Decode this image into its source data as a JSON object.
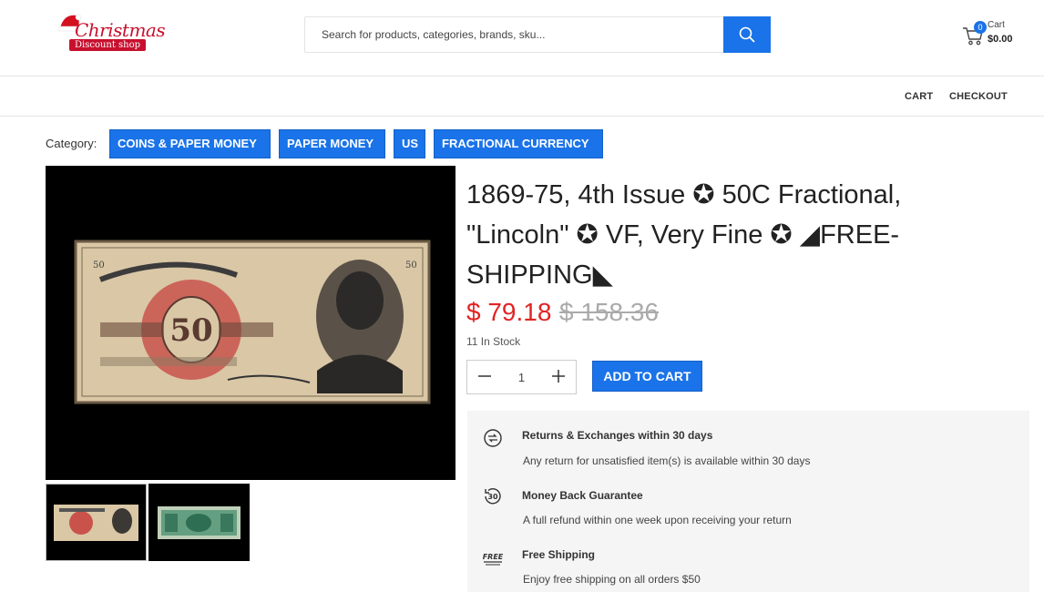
{
  "logo": {
    "title": "Christmas",
    "subtitle": "Discount shop"
  },
  "search": {
    "placeholder": "Search for products, categories, brands, sku..."
  },
  "cart_mini": {
    "count": "0",
    "label": "Cart",
    "total": "$0.00"
  },
  "nav": {
    "cart": "CART",
    "checkout": "CHECKOUT"
  },
  "category": {
    "label": "Category",
    "items": [
      "COINS & PAPER MONEY",
      "PAPER MONEY",
      "US",
      "FRACTIONAL CURRENCY"
    ]
  },
  "product": {
    "title": "1869-75, 4th Issue ✪ 50C Fractional, \"Lincoln\" ✪ VF, Very Fine ✪ ◢FREE-SHIPPING◣",
    "price": "$ 79.18",
    "old_price": "$ 158.36",
    "stock": "11 In Stock",
    "quantity": "1",
    "add_to_cart": "ADD TO CART",
    "main_image_icon": "fractional-note-lincoln-front",
    "thumbnails": [
      "fractional-note-front-thumb",
      "fractional-note-back-thumb"
    ]
  },
  "policies": [
    {
      "icon": "exchange-icon",
      "title": "Returns & Exchanges within 30 days",
      "desc": "Any return for unsatisfied item(s) is available within 30 days"
    },
    {
      "icon": "money-back-icon",
      "title": "Money Back Guarantee",
      "desc": "A full refund within one week upon receiving your return"
    },
    {
      "icon": "free-shipping-icon",
      "title": "Free Shipping",
      "desc": "Enjoy free shipping on all orders $50"
    }
  ],
  "colors": {
    "accent": "#1a73e8",
    "price": "#e02424",
    "old_price": "#aaaaaa",
    "logo_red": "#c8102e"
  }
}
